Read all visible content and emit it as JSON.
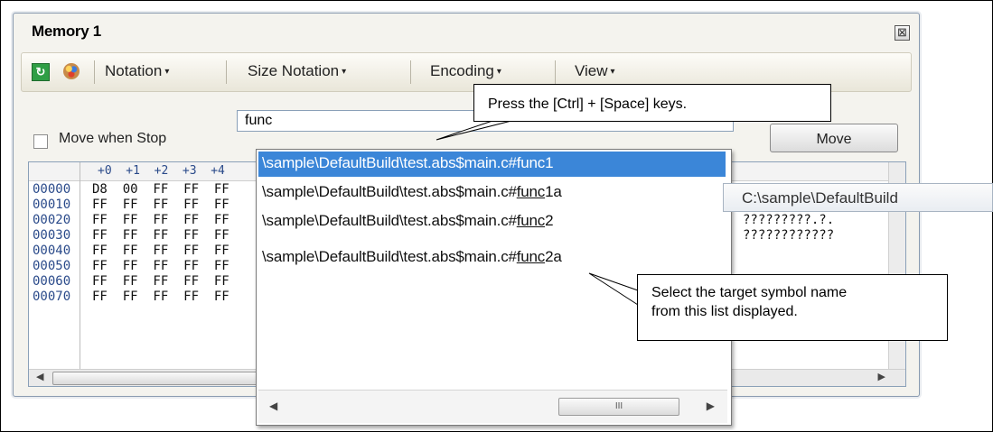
{
  "window": {
    "title": "Memory 1",
    "close_glyph": "⊠"
  },
  "toolbar": {
    "refresh_icon": "refresh-icon",
    "palette_icon": "palette-icon",
    "menus": [
      {
        "label": "Notation",
        "arrow": "▾"
      },
      {
        "label": "Size Notation",
        "arrow": "▾"
      },
      {
        "label": "Encoding",
        "arrow": "▾"
      },
      {
        "label": "View",
        "arrow": "▾"
      }
    ]
  },
  "controls": {
    "move_when_stop_label": "Move when Stop",
    "address_value": "func",
    "move_button_label": "Move"
  },
  "memory_grid": {
    "column_headers": "+0  +1  +2  +3  +4",
    "rows": [
      {
        "address": "00000",
        "bytes": "D8  00  FF  FF  FF",
        "ascii": ""
      },
      {
        "address": "00010",
        "bytes": "FF  FF  FF  FF  FF",
        "ascii": ""
      },
      {
        "address": "00020",
        "bytes": "FF  FF  FF  FF  FF",
        "ascii": "?????????.?."
      },
      {
        "address": "00030",
        "bytes": "FF  FF  FF  FF  FF",
        "ascii": "????????????"
      },
      {
        "address": "00040",
        "bytes": "FF  FF  FF  FF  FF",
        "ascii": ""
      },
      {
        "address": "00050",
        "bytes": "FF  FF  FF  FF  FF",
        "ascii": ""
      },
      {
        "address": "00060",
        "bytes": "FF  FF  FF  FF  FF",
        "ascii": ""
      },
      {
        "address": "00070",
        "bytes": "FF  FF  FF  FF  FF",
        "ascii": "????????????"
      }
    ]
  },
  "completion_list": {
    "items": [
      {
        "prefix": "\\sample\\DefaultBuild\\test.abs$main.c#",
        "match": "func",
        "suffix": "1",
        "selected": true
      },
      {
        "prefix": "\\sample\\DefaultBuild\\test.abs$main.c#",
        "match": "func",
        "suffix": "1a",
        "selected": false
      },
      {
        "prefix": "\\sample\\DefaultBuild\\test.abs$main.c#",
        "match": "func",
        "suffix": "2",
        "selected": false
      },
      {
        "prefix": "\\sample\\DefaultBuild\\test.abs$main.c#",
        "match": "func",
        "suffix": "2a",
        "selected": false
      }
    ],
    "scroll_thumb_grip": "III"
  },
  "tooltip": {
    "text": "C:\\sample\\DefaultBuild"
  },
  "callouts": {
    "keys_hint": "Press the [Ctrl] + [Space] keys.",
    "select_hint_line1": "Select the target symbol name",
    "select_hint_line2": "from this list displayed."
  }
}
